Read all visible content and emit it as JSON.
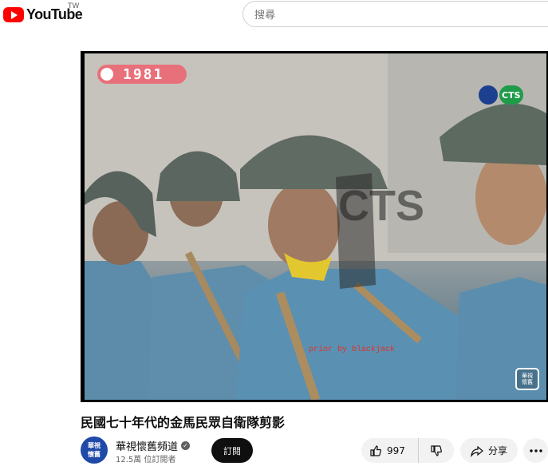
{
  "header": {
    "logo_text": "YouTube",
    "region": "TW",
    "search_placeholder": "搜尋"
  },
  "player": {
    "year_overlay": "1981",
    "station_logo": "CTS",
    "watermark": "CTS",
    "caption": "prior by blackjack",
    "corner_badge_line1": "華視",
    "corner_badge_line2": "懷舊"
  },
  "video": {
    "title": "民國七十年代的金馬民眾自衛隊剪影"
  },
  "channel": {
    "avatar_line1": "華視",
    "avatar_line2": "懷舊",
    "name": "華視懷舊頻道",
    "subscribers": "12.5萬 位訂閱者",
    "subscribe_label": "訂閱"
  },
  "actions": {
    "like_count": "997",
    "share_label": "分享"
  },
  "colors": {
    "brand_red": "#ff0000",
    "year_overlay_bg": "#e8707a",
    "uniform_blue": "#5b8fb0",
    "helmet": "#5e6a63"
  }
}
